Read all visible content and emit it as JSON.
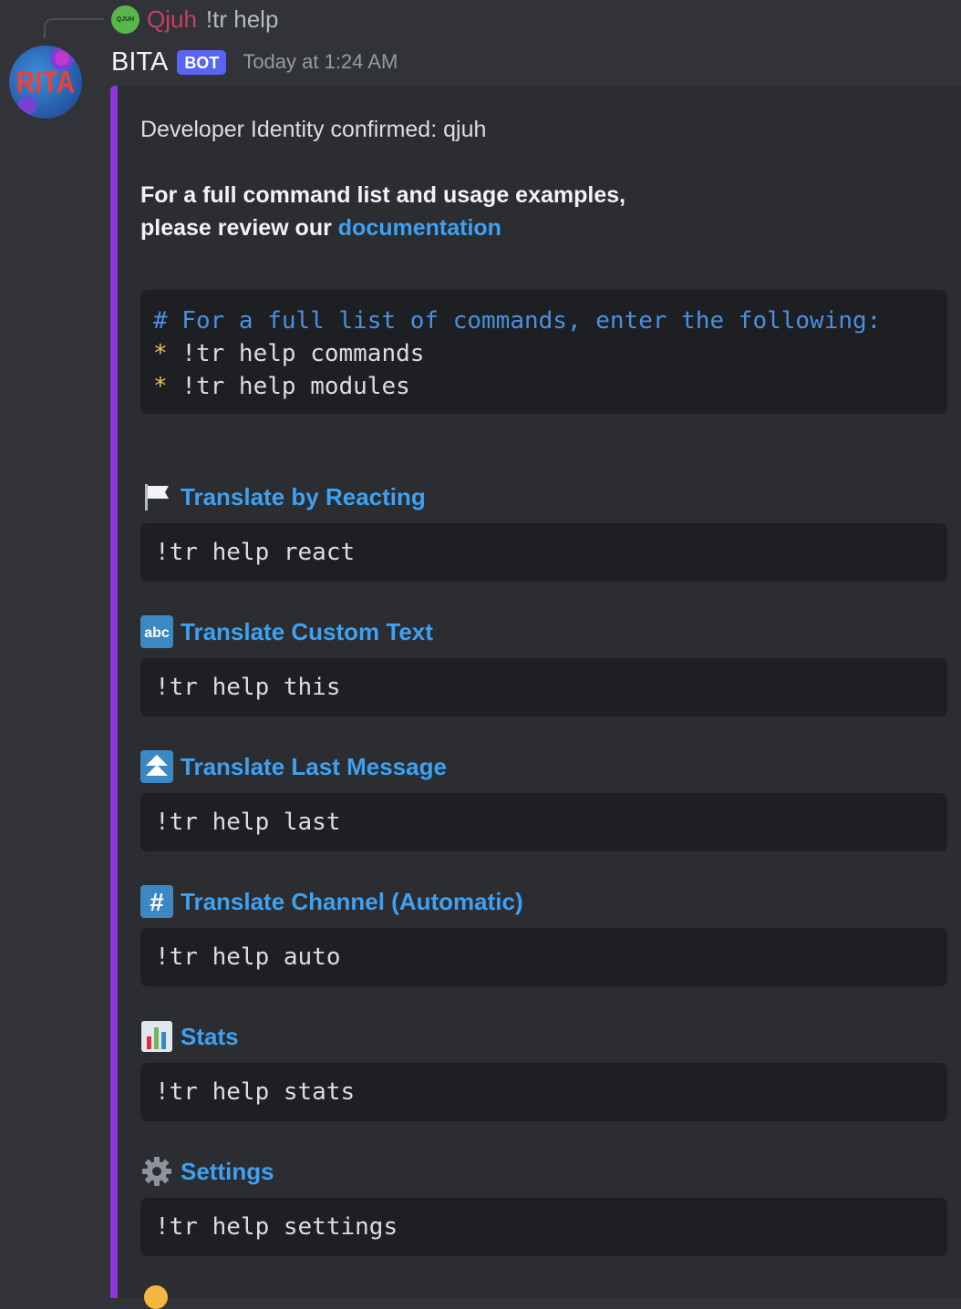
{
  "reply": {
    "avatar_text": "QJUH",
    "author": "Qjuh",
    "content": "!tr help"
  },
  "message": {
    "author": "BITA",
    "avatar_text": "RITA",
    "bot_tag": "BOT",
    "timestamp": "Today at 1:24 AM"
  },
  "embed": {
    "accent_color": "#8b35dd",
    "intro": "Developer Identity confirmed: qjuh",
    "doc_line1": "For a full command list and usage examples,",
    "doc_line2_prefix": "please review our ",
    "doc_link": "documentation",
    "code_block": {
      "comment": "# For a full list of commands, enter the following:",
      "bullets": [
        {
          "star": "*",
          "cmd": " !tr help commands"
        },
        {
          "star": "*",
          "cmd": " !tr help modules"
        }
      ]
    },
    "fields": [
      {
        "icon": "white-flag-icon",
        "title": "Translate by Reacting",
        "command": "!tr help react"
      },
      {
        "icon": "abc-icon",
        "title": "Translate Custom Text",
        "command": "!tr help this"
      },
      {
        "icon": "fast-up-icon",
        "title": "Translate Last Message",
        "command": "!tr help last"
      },
      {
        "icon": "hash-icon",
        "title": "Translate Channel (Automatic)",
        "command": "!tr help auto"
      },
      {
        "icon": "bar-chart-icon",
        "title": "Stats",
        "command": "!tr help stats"
      },
      {
        "icon": "gear-icon",
        "title": "Settings",
        "command": "!tr help settings"
      }
    ]
  }
}
